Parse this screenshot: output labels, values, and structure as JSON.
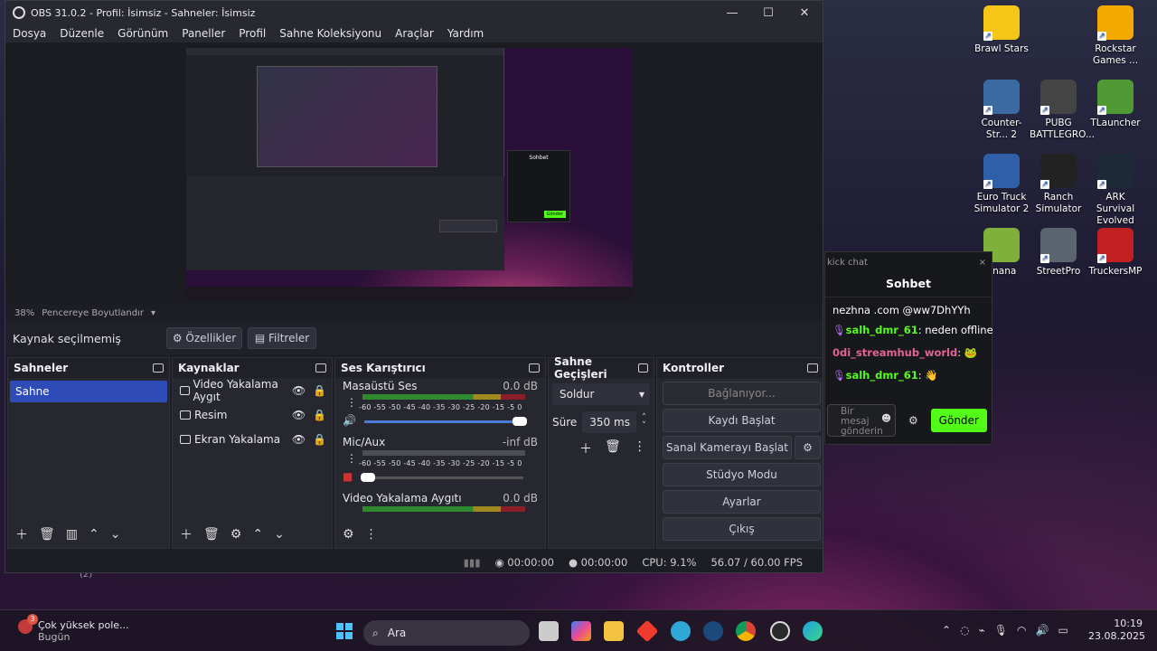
{
  "obs": {
    "title": "OBS 31.0.2 - Profil: İsimsiz - Sahneler: İsimsiz",
    "menu": [
      "Dosya",
      "Düzenle",
      "Görünüm",
      "Paneller",
      "Profil",
      "Sahne Koleksiyonu",
      "Araçlar",
      "Yardım"
    ],
    "zoom": "38%",
    "fit_label": "Pencereye Boyutlandır",
    "no_source": "Kaynak seçilmemiş",
    "properties": "Özellikler",
    "filters": "Filtreler",
    "scenes_title": "Sahneler",
    "scenes": [
      "Sahne"
    ],
    "sources_title": "Kaynaklar",
    "sources": [
      "Video Yakalama Aygıt",
      "Resim",
      "Ekran Yakalama"
    ],
    "mixer_title": "Ses Karıştırıcı",
    "channels": [
      {
        "name": "Masaüstü Ses",
        "db": "0.0 dB"
      },
      {
        "name": "Mic/Aux",
        "db": "-inf dB"
      },
      {
        "name": "Video Yakalama Aygıtı",
        "db": "0.0 dB"
      }
    ],
    "scale": "-60 -55 -50 -45 -40 -35 -30 -25 -20 -15  -5  0",
    "transitions_title": "Sahne Geçişleri",
    "transition": "Soldur",
    "duration_label": "Süre",
    "duration": "350 ms",
    "controls_title": "Kontroller",
    "controls": {
      "connecting": "Bağlanıyor...",
      "record": "Kaydı Başlat",
      "virtual_cam": "Sanal Kamerayı Başlat",
      "studio": "Stüdyo Modu",
      "settings": "Ayarlar",
      "exit": "Çıkış"
    },
    "status": {
      "stream_time": "00:00:00",
      "rec_time": "00:00:00",
      "cpu": "CPU: 9.1%",
      "fps": "56.07 / 60.00 FPS"
    }
  },
  "preview_mini": {
    "chat_title": "Sohbet",
    "send": "Gönder"
  },
  "kick": {
    "header": "kick chat",
    "title": "Sohbet",
    "line0": "nezhna .com @ww7DhYYh",
    "messages": [
      {
        "user": "salh_dmr_61",
        "text": ": neden offline"
      },
      {
        "user": "0di_streamhub_world",
        "text": ":"
      },
      {
        "user": "salh_dmr_61",
        "text": ":"
      }
    ],
    "input_placeholder": "Bir mesaj gönderin",
    "send": "Gönder"
  },
  "desktop": {
    "icons": [
      {
        "label": "Brawl Stars",
        "color": "#f5c518"
      },
      {
        "label": "Rockstar Games ...",
        "color": "#f2a900"
      },
      {
        "label": "Counter-Str... 2",
        "color": "#3b6aa0"
      },
      {
        "label": "PUBG BATTLEGRO...",
        "color": "#444"
      },
      {
        "label": "TLauncher",
        "color": "#4f9a34"
      },
      {
        "label": "Euro Truck Simulator 2",
        "color": "#2e5fa8"
      },
      {
        "label": "Ranch Simulator",
        "color": "#222"
      },
      {
        "label": "ARK Survival Evolved",
        "color": "#1b2a36"
      },
      {
        "label": "anana",
        "color": "#7fb03c"
      },
      {
        "label": "StreetPro",
        "color": "#5c6470"
      },
      {
        "label": "TruckersMP",
        "color": "#c02020"
      }
    ],
    "stray": "(2)"
  },
  "taskbar": {
    "weather_badge": "3",
    "weather": "Çok yüksek pole...",
    "weather_sub": "Bugün",
    "search": "Ara",
    "time": "10:19",
    "date": "23.08.2025"
  }
}
